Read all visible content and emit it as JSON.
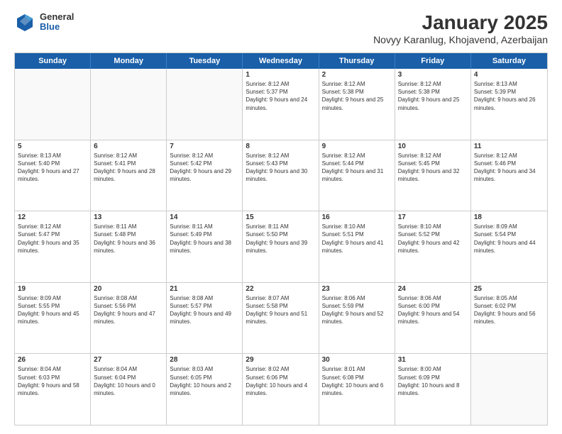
{
  "header": {
    "logo": {
      "general": "General",
      "blue": "Blue"
    },
    "title": "January 2025",
    "subtitle": "Novyy Karanlug, Khojavend, Azerbaijan"
  },
  "calendar": {
    "days": [
      "Sunday",
      "Monday",
      "Tuesday",
      "Wednesday",
      "Thursday",
      "Friday",
      "Saturday"
    ],
    "rows": [
      [
        {
          "day": "",
          "empty": true
        },
        {
          "day": "",
          "empty": true
        },
        {
          "day": "",
          "empty": true
        },
        {
          "day": "1",
          "sunrise": "Sunrise: 8:12 AM",
          "sunset": "Sunset: 5:37 PM",
          "daylight": "Daylight: 9 hours and 24 minutes."
        },
        {
          "day": "2",
          "sunrise": "Sunrise: 8:12 AM",
          "sunset": "Sunset: 5:38 PM",
          "daylight": "Daylight: 9 hours and 25 minutes."
        },
        {
          "day": "3",
          "sunrise": "Sunrise: 8:12 AM",
          "sunset": "Sunset: 5:38 PM",
          "daylight": "Daylight: 9 hours and 25 minutes."
        },
        {
          "day": "4",
          "sunrise": "Sunrise: 8:13 AM",
          "sunset": "Sunset: 5:39 PM",
          "daylight": "Daylight: 9 hours and 26 minutes."
        }
      ],
      [
        {
          "day": "5",
          "sunrise": "Sunrise: 8:13 AM",
          "sunset": "Sunset: 5:40 PM",
          "daylight": "Daylight: 9 hours and 27 minutes."
        },
        {
          "day": "6",
          "sunrise": "Sunrise: 8:12 AM",
          "sunset": "Sunset: 5:41 PM",
          "daylight": "Daylight: 9 hours and 28 minutes."
        },
        {
          "day": "7",
          "sunrise": "Sunrise: 8:12 AM",
          "sunset": "Sunset: 5:42 PM",
          "daylight": "Daylight: 9 hours and 29 minutes."
        },
        {
          "day": "8",
          "sunrise": "Sunrise: 8:12 AM",
          "sunset": "Sunset: 5:43 PM",
          "daylight": "Daylight: 9 hours and 30 minutes."
        },
        {
          "day": "9",
          "sunrise": "Sunrise: 8:12 AM",
          "sunset": "Sunset: 5:44 PM",
          "daylight": "Daylight: 9 hours and 31 minutes."
        },
        {
          "day": "10",
          "sunrise": "Sunrise: 8:12 AM",
          "sunset": "Sunset: 5:45 PM",
          "daylight": "Daylight: 9 hours and 32 minutes."
        },
        {
          "day": "11",
          "sunrise": "Sunrise: 8:12 AM",
          "sunset": "Sunset: 5:46 PM",
          "daylight": "Daylight: 9 hours and 34 minutes."
        }
      ],
      [
        {
          "day": "12",
          "sunrise": "Sunrise: 8:12 AM",
          "sunset": "Sunset: 5:47 PM",
          "daylight": "Daylight: 9 hours and 35 minutes."
        },
        {
          "day": "13",
          "sunrise": "Sunrise: 8:11 AM",
          "sunset": "Sunset: 5:48 PM",
          "daylight": "Daylight: 9 hours and 36 minutes."
        },
        {
          "day": "14",
          "sunrise": "Sunrise: 8:11 AM",
          "sunset": "Sunset: 5:49 PM",
          "daylight": "Daylight: 9 hours and 38 minutes."
        },
        {
          "day": "15",
          "sunrise": "Sunrise: 8:11 AM",
          "sunset": "Sunset: 5:50 PM",
          "daylight": "Daylight: 9 hours and 39 minutes."
        },
        {
          "day": "16",
          "sunrise": "Sunrise: 8:10 AM",
          "sunset": "Sunset: 5:51 PM",
          "daylight": "Daylight: 9 hours and 41 minutes."
        },
        {
          "day": "17",
          "sunrise": "Sunrise: 8:10 AM",
          "sunset": "Sunset: 5:52 PM",
          "daylight": "Daylight: 9 hours and 42 minutes."
        },
        {
          "day": "18",
          "sunrise": "Sunrise: 8:09 AM",
          "sunset": "Sunset: 5:54 PM",
          "daylight": "Daylight: 9 hours and 44 minutes."
        }
      ],
      [
        {
          "day": "19",
          "sunrise": "Sunrise: 8:09 AM",
          "sunset": "Sunset: 5:55 PM",
          "daylight": "Daylight: 9 hours and 45 minutes."
        },
        {
          "day": "20",
          "sunrise": "Sunrise: 8:08 AM",
          "sunset": "Sunset: 5:56 PM",
          "daylight": "Daylight: 9 hours and 47 minutes."
        },
        {
          "day": "21",
          "sunrise": "Sunrise: 8:08 AM",
          "sunset": "Sunset: 5:57 PM",
          "daylight": "Daylight: 9 hours and 49 minutes."
        },
        {
          "day": "22",
          "sunrise": "Sunrise: 8:07 AM",
          "sunset": "Sunset: 5:58 PM",
          "daylight": "Daylight: 9 hours and 51 minutes."
        },
        {
          "day": "23",
          "sunrise": "Sunrise: 8:06 AM",
          "sunset": "Sunset: 5:59 PM",
          "daylight": "Daylight: 9 hours and 52 minutes."
        },
        {
          "day": "24",
          "sunrise": "Sunrise: 8:06 AM",
          "sunset": "Sunset: 6:00 PM",
          "daylight": "Daylight: 9 hours and 54 minutes."
        },
        {
          "day": "25",
          "sunrise": "Sunrise: 8:05 AM",
          "sunset": "Sunset: 6:02 PM",
          "daylight": "Daylight: 9 hours and 56 minutes."
        }
      ],
      [
        {
          "day": "26",
          "sunrise": "Sunrise: 8:04 AM",
          "sunset": "Sunset: 6:03 PM",
          "daylight": "Daylight: 9 hours and 58 minutes."
        },
        {
          "day": "27",
          "sunrise": "Sunrise: 8:04 AM",
          "sunset": "Sunset: 6:04 PM",
          "daylight": "Daylight: 10 hours and 0 minutes."
        },
        {
          "day": "28",
          "sunrise": "Sunrise: 8:03 AM",
          "sunset": "Sunset: 6:05 PM",
          "daylight": "Daylight: 10 hours and 2 minutes."
        },
        {
          "day": "29",
          "sunrise": "Sunrise: 8:02 AM",
          "sunset": "Sunset: 6:06 PM",
          "daylight": "Daylight: 10 hours and 4 minutes."
        },
        {
          "day": "30",
          "sunrise": "Sunrise: 8:01 AM",
          "sunset": "Sunset: 6:08 PM",
          "daylight": "Daylight: 10 hours and 6 minutes."
        },
        {
          "day": "31",
          "sunrise": "Sunrise: 8:00 AM",
          "sunset": "Sunset: 6:09 PM",
          "daylight": "Daylight: 10 hours and 8 minutes."
        },
        {
          "day": "",
          "empty": true
        }
      ]
    ]
  }
}
